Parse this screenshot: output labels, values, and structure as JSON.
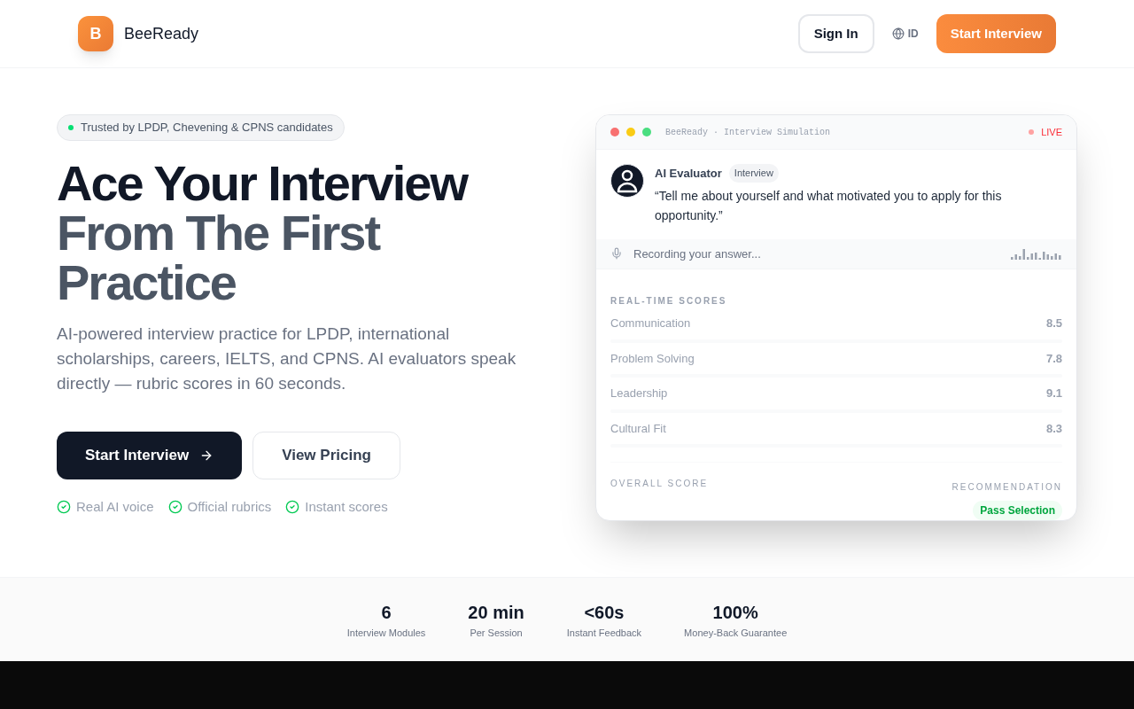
{
  "nav": {
    "logo_letter": "B",
    "brand": "BeeReady",
    "sign_in": "Sign In",
    "language": "ID",
    "cta": "Start Interview"
  },
  "hero": {
    "badge": "Trusted by LPDP, Chevening & CPNS candidates",
    "title_line1": "Ace Your Interview",
    "title_line2": "From The First Practice",
    "subtitle": "AI-powered interview practice for LPDP, international scholarships, careers, IELTS, and CPNS. AI evaluators speak directly — rubric scores in 60 seconds.",
    "primary_button": "Start Interview",
    "secondary_button": "View Pricing",
    "features": [
      "Real AI voice",
      "Official rubrics",
      "Instant scores"
    ]
  },
  "demo": {
    "window_title": "BeeReady · Interview Simulation",
    "status": "LIVE",
    "speaker": "AI Evaluator",
    "speaker_tag": "Interview",
    "question": "“Tell me about yourself and what motivated you to apply for this opportunity.”",
    "recording": "Recording your answer...",
    "scores_heading": "REAL-TIME SCORES",
    "scores": [
      {
        "name": "Communication",
        "value": "8.5"
      },
      {
        "name": "Problem Solving",
        "value": "7.8"
      },
      {
        "name": "Leadership",
        "value": "9.1"
      },
      {
        "name": "Cultural Fit",
        "value": "8.3"
      }
    ],
    "overall_label": "OVERALL SCORE",
    "recommendation_label": "RECOMMENDATION",
    "recommendation": "Pass Selection"
  },
  "stats": [
    {
      "value": "6",
      "label": "Interview Modules"
    },
    {
      "value": "20 min",
      "label": "Per Session"
    },
    {
      "value": "<60s",
      "label": "Instant Feedback"
    },
    {
      "value": "100%",
      "label": "Money-Back Guarantee"
    }
  ]
}
